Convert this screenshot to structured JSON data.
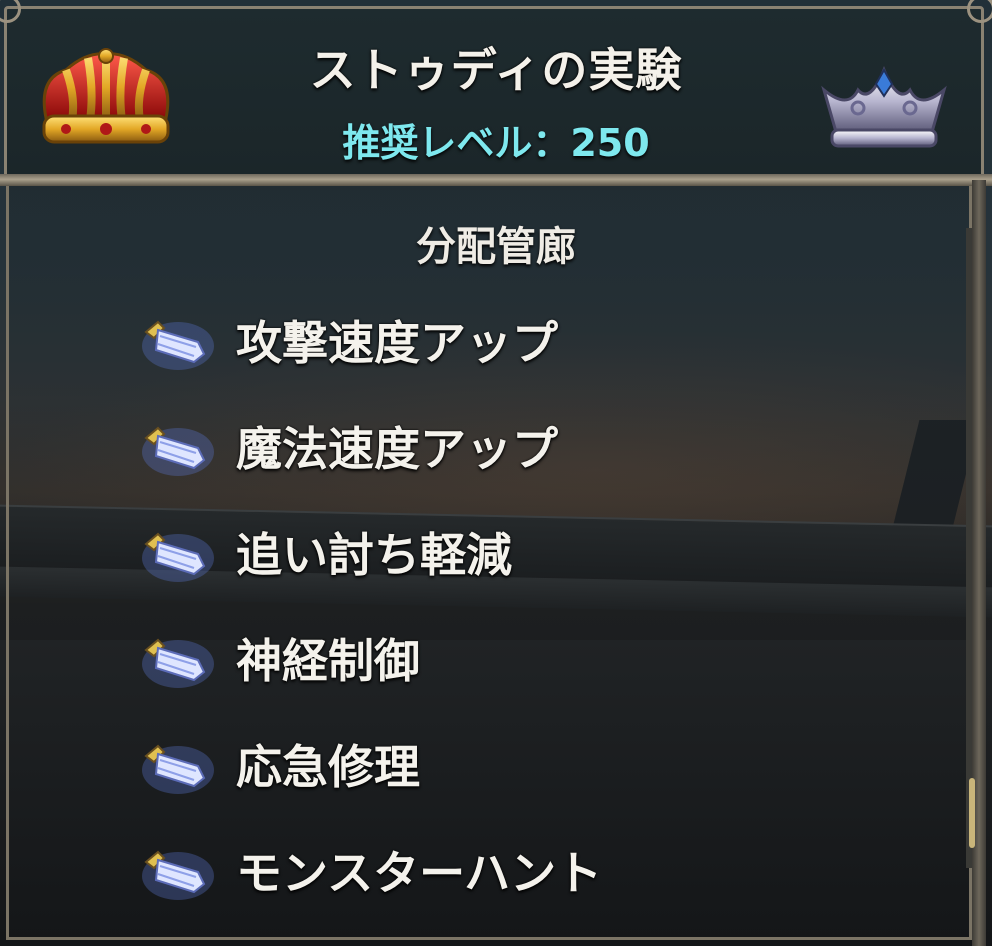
{
  "header": {
    "title": "ストゥディの実験",
    "recommended_level": "推奨レベル：250"
  },
  "section": {
    "title": "分配管廊"
  },
  "items": [
    {
      "label": "攻撃速度アップ",
      "icon": "crystal-icon"
    },
    {
      "label": "魔法速度アップ",
      "icon": "crystal-icon"
    },
    {
      "label": "追い討ち軽減",
      "icon": "crystal-icon"
    },
    {
      "label": "神経制御",
      "icon": "crystal-icon"
    },
    {
      "label": "応急修理",
      "icon": "crystal-icon"
    },
    {
      "label": "モンスターハント",
      "icon": "crystal-icon"
    }
  ],
  "colors": {
    "title_text": "#f4f1ea",
    "level_text": "#7ee8ee",
    "frame": "#8a8272",
    "scroll_thumb": "#c9b57a"
  }
}
